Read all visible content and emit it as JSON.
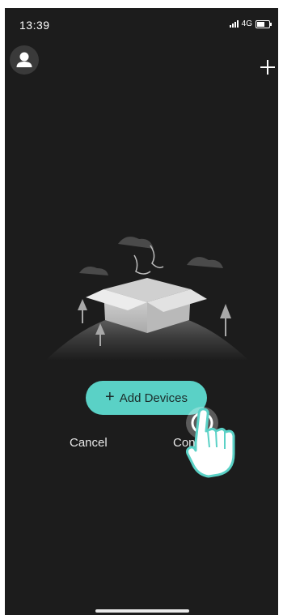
{
  "status_bar": {
    "time": "13:39",
    "network": "4G"
  },
  "header": {
    "avatar_icon": "person-icon",
    "add_icon": "plus-icon"
  },
  "main": {
    "illustration_icon": "open-box-icon",
    "add_devices_label": "Add Devices",
    "cancel_label": "Cancel",
    "continue_label": "Continue",
    "pointer_icon": "pointing-hand-icon"
  },
  "colors": {
    "background": "#1c1c1c",
    "accent": "#5ad1c6"
  }
}
